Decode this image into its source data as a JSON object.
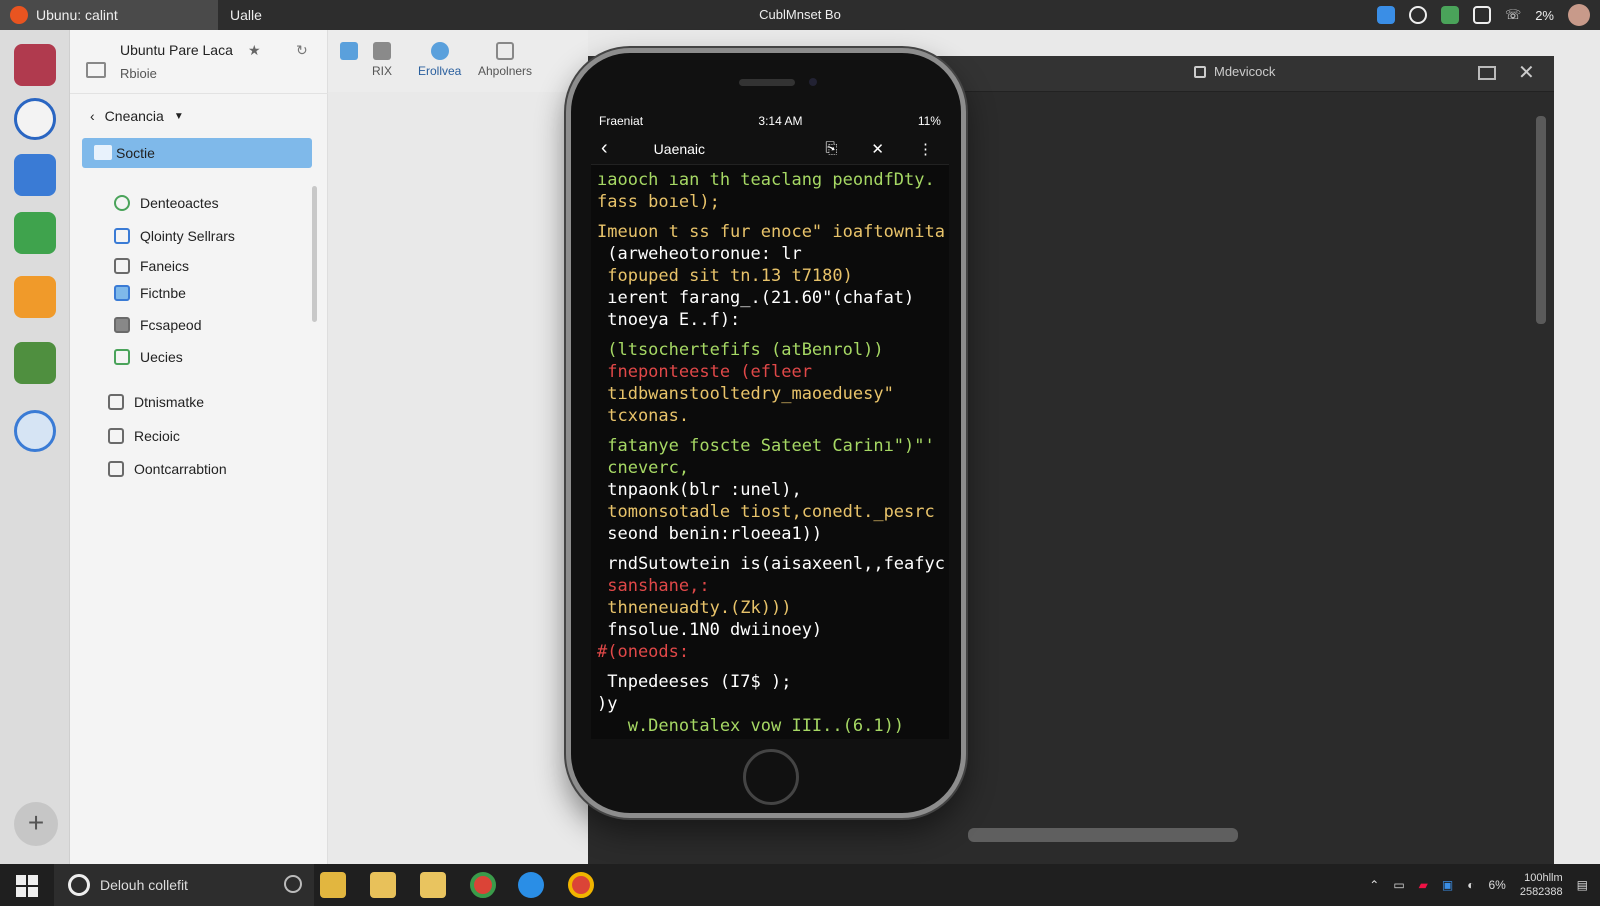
{
  "titlebar": {
    "tab_active": "Ubunu: calint",
    "tab_second": "Ualle",
    "window_title": "CublMnset Bo",
    "tray_battery": "2%"
  },
  "dock": {
    "icons": [
      "app-red-icon",
      "firefox-icon",
      "document-icon",
      "spreadsheet-icon",
      "presentation-icon",
      "settings-icon",
      "remote-icon"
    ],
    "add_label": "+"
  },
  "file_manager": {
    "title": "Ubuntu Pare Laca",
    "subtitle": "Rbioie",
    "breadcrumb": "Cneancia",
    "selected": "Soctie",
    "items": [
      {
        "label": "Denteoactes",
        "icon": "shield-icon"
      },
      {
        "label": "Qlointy Sellrars",
        "icon": "document-icon"
      },
      {
        "label": "Faneics",
        "icon": "folder-icon"
      },
      {
        "label": "Fictnbe",
        "icon": "image-icon"
      },
      {
        "label": "Fcsapeod",
        "icon": "mail-icon"
      },
      {
        "label": "Uecies",
        "icon": "grid-icon"
      },
      {
        "label": "Dtnismatke",
        "icon": "file-icon"
      },
      {
        "label": "Recioic",
        "icon": "list-icon"
      },
      {
        "label": "Oontcarrabtion",
        "icon": "checkbox-icon"
      }
    ]
  },
  "toolbar": {
    "btn1": "",
    "btn2": "RIX",
    "btn3": "Erollvea",
    "btn4": "Ahpolners"
  },
  "panel": {
    "lock_label": "Mdevicock"
  },
  "phone": {
    "carrier": "Fraeniat",
    "time": "3:14 AM",
    "battery": "11%",
    "screen_title": "Uaenaic",
    "code_lines": [
      {
        "text": "ıaooch ıan th teaclang peondfDty.",
        "color": "#a6d864"
      },
      {
        "text": "fass boıel);",
        "color": "#e8c36a"
      },
      {
        "text": "",
        "color": "#fff"
      },
      {
        "text": "Imeuon t ss fur enoce\" ioaftownita",
        "color": "#e8c36a"
      },
      {
        "text": " (arweheotoronue: lr",
        "color": "#ffffff"
      },
      {
        "text": " fopuped sit tn.13 t7180)",
        "color": "#e8c36a"
      },
      {
        "text": " ıerent farang_.(21.60\"(chafat)",
        "color": "#ffffff"
      },
      {
        "text": " tnoeya E..f):",
        "color": "#ffffff"
      },
      {
        "text": "",
        "color": "#fff"
      },
      {
        "text": " (ltsochertefifs (atBenrol))",
        "color": "#a6d864"
      },
      {
        "text": " fneponteeste (efleer",
        "color": "#e04848"
      },
      {
        "text": " tıdbwanstooltedry_maoeduesy\"",
        "color": "#e8c36a"
      },
      {
        "text": " tcxonas.",
        "color": "#e8c36a"
      },
      {
        "text": "",
        "color": "#fff"
      },
      {
        "text": " fatanye foscte Sateet Carinı\")\"'",
        "color": "#a6d864"
      },
      {
        "text": " cneverc,",
        "color": "#a6d864"
      },
      {
        "text": " tnpaonk(blr :unel),",
        "color": "#ffffff"
      },
      {
        "text": " tomonsotadle tiost,conedt._pesrc",
        "color": "#e8c36a"
      },
      {
        "text": " seond benin:rloeea1))",
        "color": "#ffffff"
      },
      {
        "text": "",
        "color": "#fff"
      },
      {
        "text": " rndSutowtein is(aisaxeenl,,feafyc",
        "color": "#ffffff"
      },
      {
        "text": " sanshane,:",
        "color": "#e04848"
      },
      {
        "text": " thneneuadty.(Zk)))",
        "color": "#e8c36a"
      },
      {
        "text": " fnsolue.1N0 dwiinoey)",
        "color": "#ffffff"
      },
      {
        "text": "#(oneods:",
        "color": "#e04848"
      },
      {
        "text": "",
        "color": "#fff"
      },
      {
        "text": " Tnpedeeses (I7$ );",
        "color": "#ffffff"
      },
      {
        "text": ")y",
        "color": "#ffffff"
      },
      {
        "text": "   w.Denotalex vow III..(6.1))",
        "color": "#a6d864"
      }
    ]
  },
  "taskbar": {
    "search_placeholder": "Delouh collefit",
    "clock_time": "100hllm",
    "clock_date": "2582388",
    "tray_pct": "6%"
  }
}
